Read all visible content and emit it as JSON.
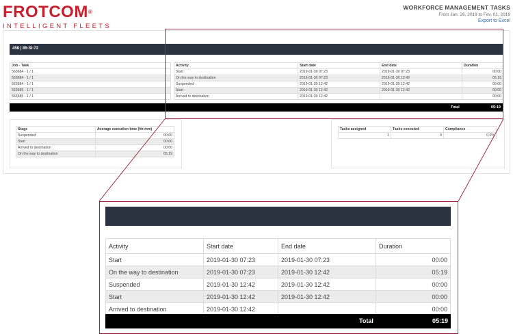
{
  "brand": {
    "name": "FROTCOM",
    "registered": "®",
    "tagline": "INTELLIGENT FLEETS",
    "color": "#c8202f"
  },
  "report": {
    "title": "WORKFORCE MANAGEMENT TASKS",
    "date_range": "From Jan. 26, 2019 to Fev. 01, 2019",
    "export_label": "Export to Excel"
  },
  "vehicle": {
    "label": "458 | 85-SI-72"
  },
  "jobs_table": {
    "header": "Job - Task",
    "rows": [
      "563684 - 1 / 1",
      "563684 - 1 / 1",
      "563684 - 1 / 1",
      "563685 - 1 / 1",
      "563685 - 1 / 1"
    ]
  },
  "activities_table": {
    "headers": [
      "Activity",
      "Start date",
      "End date",
      "Duration"
    ],
    "rows": [
      [
        "Start",
        "2019-01-30 07:23",
        "2019-01-30 07:23",
        "00:00"
      ],
      [
        "On the way to destination",
        "2019-01-30 07:23",
        "2019-01-30 12:42",
        "05:19"
      ],
      [
        "Suspended",
        "2019-01-30 12:42",
        "2019-01-30 12:42",
        "00:00"
      ],
      [
        "Start",
        "2019-01-30 12:42",
        "2019-01-30 12:42",
        "00:00"
      ],
      [
        "Arrived to destination",
        "2019-01-30 12:42",
        "",
        "00:00"
      ]
    ],
    "total_label": "Total",
    "total_value": "05:19"
  },
  "stage_table": {
    "headers": [
      "Stage",
      "Average execution time (hh:mm)"
    ],
    "rows": [
      [
        "Suspended",
        "00:00"
      ],
      [
        "Start",
        "00:00"
      ],
      [
        "Arrived to destination",
        "00:00"
      ],
      [
        "On the way to destination",
        "05:19"
      ]
    ]
  },
  "tasks_table": {
    "headers": [
      "Tasks assigned",
      "Tasks executed",
      "Compliance"
    ],
    "values": [
      "1",
      "0",
      "0.0%"
    ]
  },
  "colors": {
    "dark_bar": "#2c3340",
    "callout": "#9a2f44",
    "link": "#2a6db0"
  }
}
